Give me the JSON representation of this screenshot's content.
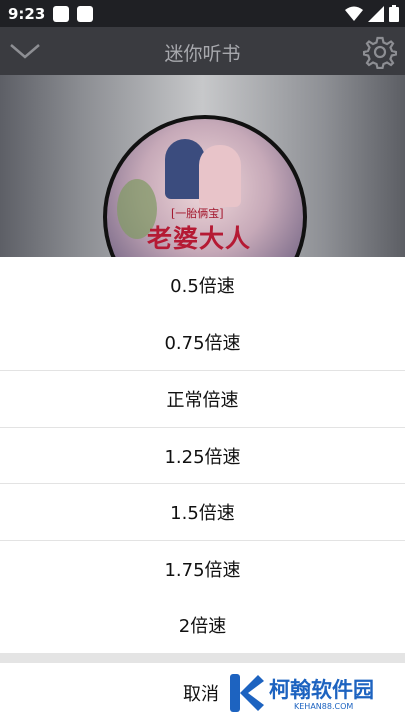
{
  "status_bar": {
    "time": "9:23"
  },
  "app_bar": {
    "title": "迷你听书"
  },
  "cover": {
    "tag": "[一胎俩宝]",
    "title": "老婆大人"
  },
  "speed_sheet": {
    "options": [
      "0.5倍速",
      "0.75倍速",
      "正常倍速",
      "1.25倍速",
      "1.5倍速",
      "1.75倍速",
      "2倍速"
    ],
    "cancel_label": "取消"
  },
  "watermark": {
    "text": "柯翰软件园",
    "sub": "KEHAN88.COM"
  },
  "colors": {
    "accent": "#1d63c0",
    "overlay": "#3a3b40"
  }
}
